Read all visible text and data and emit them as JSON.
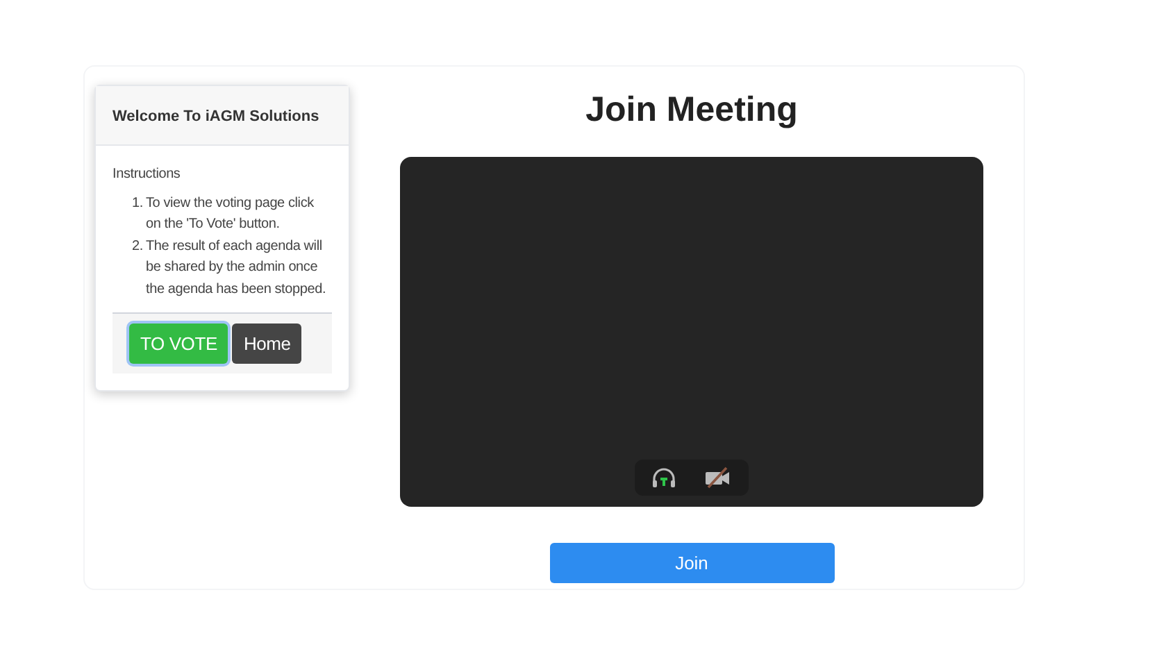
{
  "info_card": {
    "title": "Welcome To iAGM Solutions",
    "heading": "Instructions",
    "steps": [
      {
        "number": "1.",
        "text": "To view the voting page click on the 'To Vote' button."
      },
      {
        "number": "2.",
        "text": "The result of each agenda will be shared by the admin once the agenda has been stopped."
      }
    ],
    "buttons": [
      {
        "kind": "vote",
        "label": "TO VOTE",
        "focused": true
      },
      {
        "kind": "home",
        "label": "Home",
        "focused": false
      }
    ]
  },
  "meeting": {
    "title": "Join Meeting",
    "audio_on": true,
    "camera_on": false,
    "join_label": "Join"
  }
}
